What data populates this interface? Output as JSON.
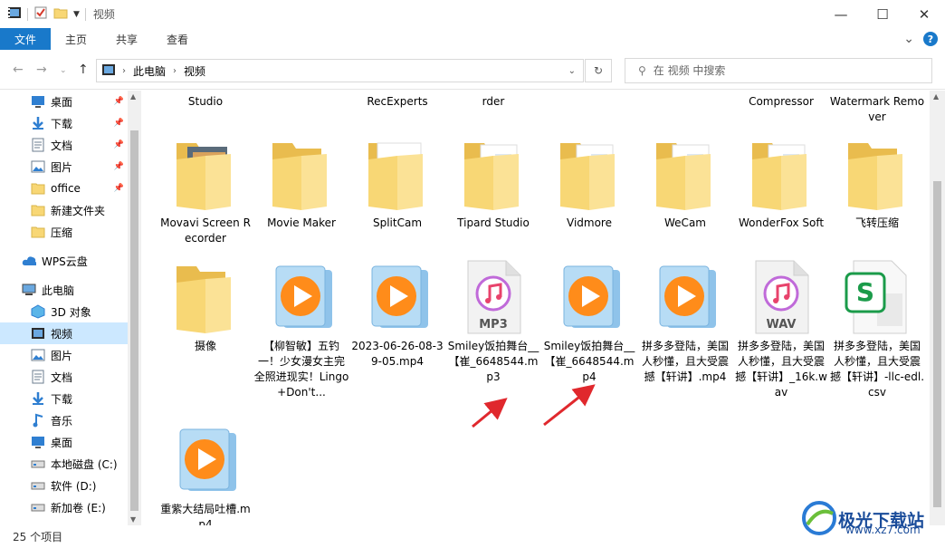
{
  "window": {
    "title": "视频",
    "minimize": "—",
    "maximize": "☐",
    "close": "✕"
  },
  "ribbon": {
    "tabs": [
      "文件",
      "主页",
      "共享",
      "查看"
    ],
    "expand": "⌄",
    "help": "?"
  },
  "address": {
    "crumbs": [
      "此电脑",
      "视频"
    ]
  },
  "search": {
    "placeholder": "在 视频 中搜索"
  },
  "sidebar": {
    "items": [
      {
        "label": "桌面",
        "icon": "desktop-icon",
        "pinned": true
      },
      {
        "label": "下载",
        "icon": "download-icon",
        "pinned": true
      },
      {
        "label": "文档",
        "icon": "document-icon",
        "pinned": true
      },
      {
        "label": "图片",
        "icon": "picture-icon",
        "pinned": true
      },
      {
        "label": "office",
        "icon": "folder-icon",
        "pinned": true
      },
      {
        "label": "新建文件夹",
        "icon": "folder-icon",
        "pinned": false
      },
      {
        "label": "压缩",
        "icon": "folder-icon",
        "pinned": false
      },
      {
        "label": "WPS云盘",
        "icon": "cloud-icon",
        "pinned": false
      },
      {
        "label": "此电脑",
        "icon": "computer-icon",
        "pinned": false
      },
      {
        "label": "3D 对象",
        "icon": "3d-objects-icon",
        "pinned": false
      },
      {
        "label": "视频",
        "icon": "video-icon",
        "pinned": false,
        "selected": true
      },
      {
        "label": "图片",
        "icon": "picture-icon",
        "pinned": false
      },
      {
        "label": "文档",
        "icon": "document-icon",
        "pinned": false
      },
      {
        "label": "下载",
        "icon": "download-icon",
        "pinned": false
      },
      {
        "label": "音乐",
        "icon": "music-icon",
        "pinned": false
      },
      {
        "label": "桌面",
        "icon": "desktop-icon",
        "pinned": false
      },
      {
        "label": "本地磁盘 (C:)",
        "icon": "drive-icon",
        "pinned": false
      },
      {
        "label": "软件 (D:)",
        "icon": "drive-icon",
        "pinned": false
      },
      {
        "label": "新加卷 (E:)",
        "icon": "drive-icon",
        "pinned": false
      }
    ]
  },
  "files": {
    "top_row": [
      "Studio",
      "RecExperts",
      "rder",
      "Compressor",
      "Watermark Remover"
    ],
    "row1": [
      {
        "label": "Movavi Screen Recorder",
        "type": "folder-photo"
      },
      {
        "label": "Movie Maker",
        "type": "folder"
      },
      {
        "label": "SplitCam",
        "type": "folder-doc"
      },
      {
        "label": "Tipard Studio",
        "type": "folder-files"
      },
      {
        "label": "Vidmore",
        "type": "folder-files"
      },
      {
        "label": "WeCam",
        "type": "folder-files"
      },
      {
        "label": "WonderFox Soft",
        "type": "folder-files"
      },
      {
        "label": "飞转压缩",
        "type": "folder"
      }
    ],
    "row2": [
      {
        "label": "摄像",
        "type": "folder"
      },
      {
        "label": "【柳智敏】五钓一！少女漫女主完全照进现实！Lingo+Don't...",
        "type": "media"
      },
      {
        "label": "2023-06-26-08-39-05.mp4",
        "type": "media"
      },
      {
        "label": "Smiley饭拍舞台__【崔_6648544.mp3",
        "type": "audio",
        "badge": "MP3"
      },
      {
        "label": "Smiley饭拍舞台__【崔_6648544.mp4",
        "type": "media"
      },
      {
        "label": "拼多多登陆，美国人秒懂，且大受震撼【轩讲】.mp4",
        "type": "media"
      },
      {
        "label": "拼多多登陆，美国人秒懂，且大受震撼【轩讲】_16k.wav",
        "type": "audio",
        "badge": "WAV"
      },
      {
        "label": "拼多多登陆，美国人秒懂，且大受震撼【轩讲】-llc-edl.csv",
        "type": "csv"
      }
    ],
    "row3": [
      {
        "label": "重紫大结局吐槽.mp4",
        "type": "media"
      }
    ]
  },
  "status": {
    "count": "25 个项目"
  },
  "watermark": {
    "text": "极光下载站",
    "url": "www.xz7.com"
  },
  "colors": {
    "accent": "#1979ca",
    "selected_bg": "#cce8ff",
    "folder": "#f8d775",
    "media": "#ff8c1a",
    "arrow": "#e0282d"
  }
}
